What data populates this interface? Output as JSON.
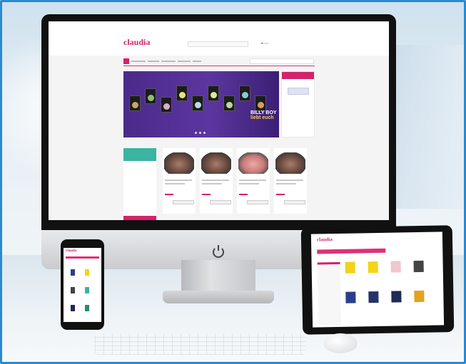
{
  "site": {
    "logo": "claudia",
    "banner_line1": "BILLY BOY",
    "banner_line2": "liebt euch"
  },
  "tablet": {
    "logo": "claudia"
  },
  "phone": {
    "logo": "claudia"
  },
  "colors": {
    "brand_pink": "#d3236b",
    "teal": "#3ab59f",
    "banner_purple": "#4a2a8a",
    "frame_blue": "#2a8ad1"
  }
}
